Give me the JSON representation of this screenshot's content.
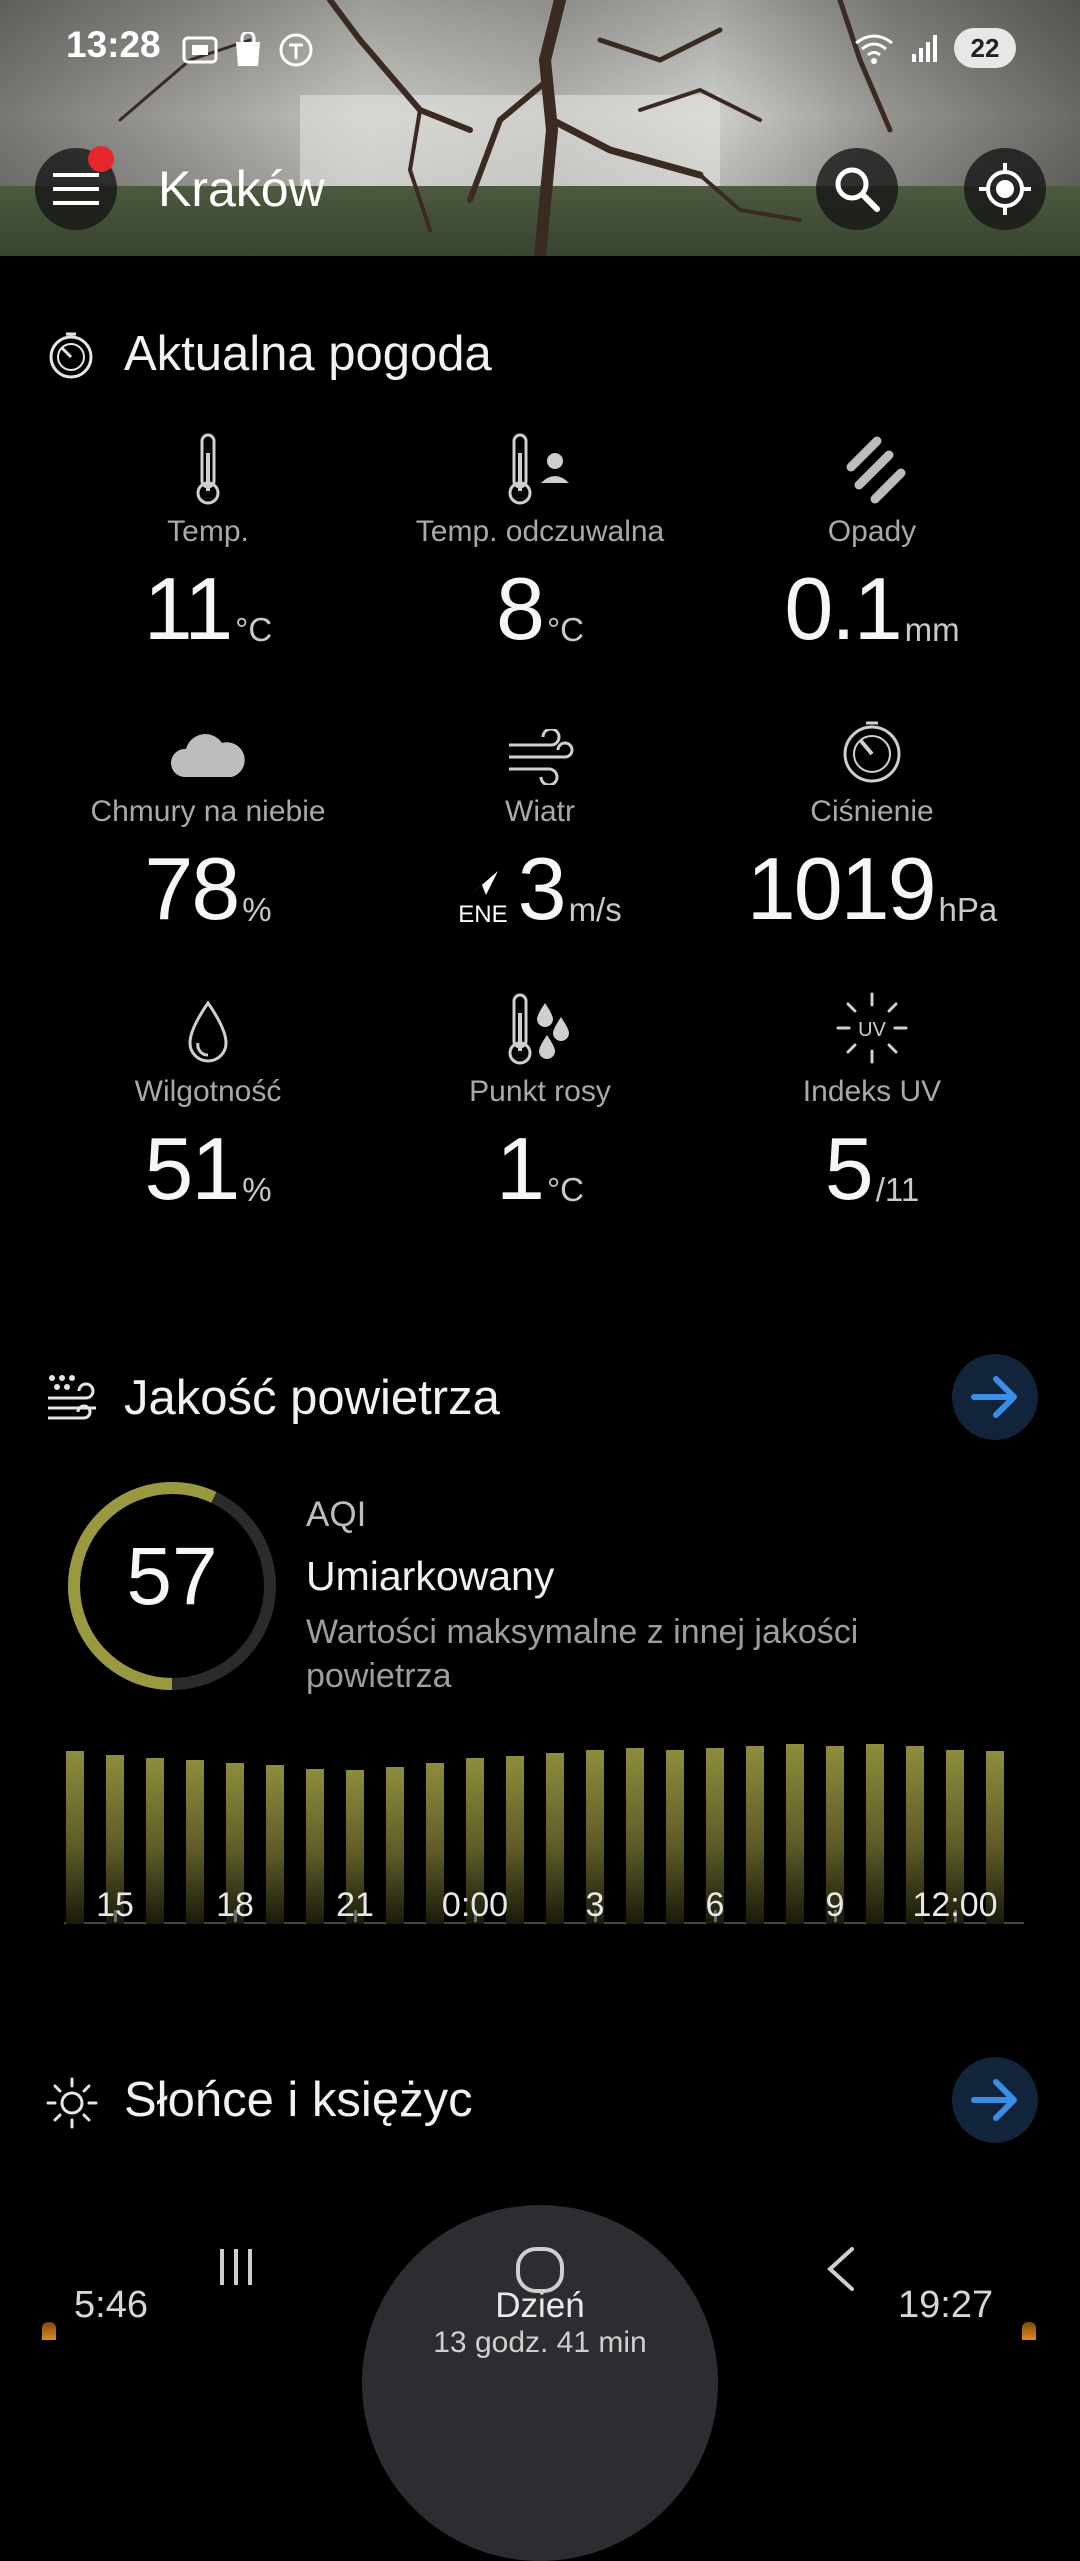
{
  "status_bar": {
    "time": "13:28",
    "battery": "22"
  },
  "header": {
    "city": "Kraków"
  },
  "current": {
    "title": "Aktualna pogoda",
    "items": [
      {
        "label": "Temp.",
        "value": "11",
        "unit": "°C",
        "icon": "thermometer-icon"
      },
      {
        "label": "Temp. odczuwalna",
        "value": "8",
        "unit": "°C",
        "icon": "feels-like-icon"
      },
      {
        "label": "Opady",
        "value": "0.1",
        "unit": "mm",
        "icon": "rain-icon"
      },
      {
        "label": "Chmury na niebie",
        "value": "78",
        "unit": "%",
        "icon": "cloud-icon"
      },
      {
        "label": "Wiatr",
        "value": "3",
        "unit": "m/s",
        "direction": "ENE",
        "icon": "wind-icon"
      },
      {
        "label": "Ciśnienie",
        "value": "1019",
        "unit": "hPa",
        "icon": "pressure-icon"
      },
      {
        "label": "Wilgotność",
        "value": "51",
        "unit": "%",
        "icon": "humidity-icon"
      },
      {
        "label": "Punkt rosy",
        "value": "1",
        "unit": "°C",
        "icon": "dew-point-icon"
      },
      {
        "label": "Indeks UV",
        "value": "5",
        "unit": "/11",
        "icon": "uv-icon"
      }
    ]
  },
  "air_quality": {
    "title": "Jakość powietrza",
    "aqi_label": "AQI",
    "aqi_value": "57",
    "aqi_max": 100,
    "level": "Umiarkowany",
    "description": "Wartości maksymalne z innej jakości powietrza",
    "colors": {
      "ring": "#9a9942",
      "bar": "#8e8d3c",
      "arrow_bg": "#12243c",
      "arrow": "#3b8ee8"
    }
  },
  "chart_data": {
    "type": "bar",
    "tick_labels": [
      "15",
      "18",
      "21",
      "0:00",
      "3",
      "6",
      "9",
      "12:00"
    ],
    "values": [
      100,
      98,
      96,
      95,
      93,
      92,
      90,
      89,
      91,
      93,
      96,
      97,
      99,
      101,
      102,
      101,
      102,
      103,
      104,
      103,
      104,
      103,
      101,
      100
    ]
  },
  "sun_moon": {
    "title": "Słońce i księżyc",
    "sunrise": "5:46",
    "sunset": "19:27",
    "day_label": "Dzień",
    "day_length": "13 godz. 41 min"
  }
}
